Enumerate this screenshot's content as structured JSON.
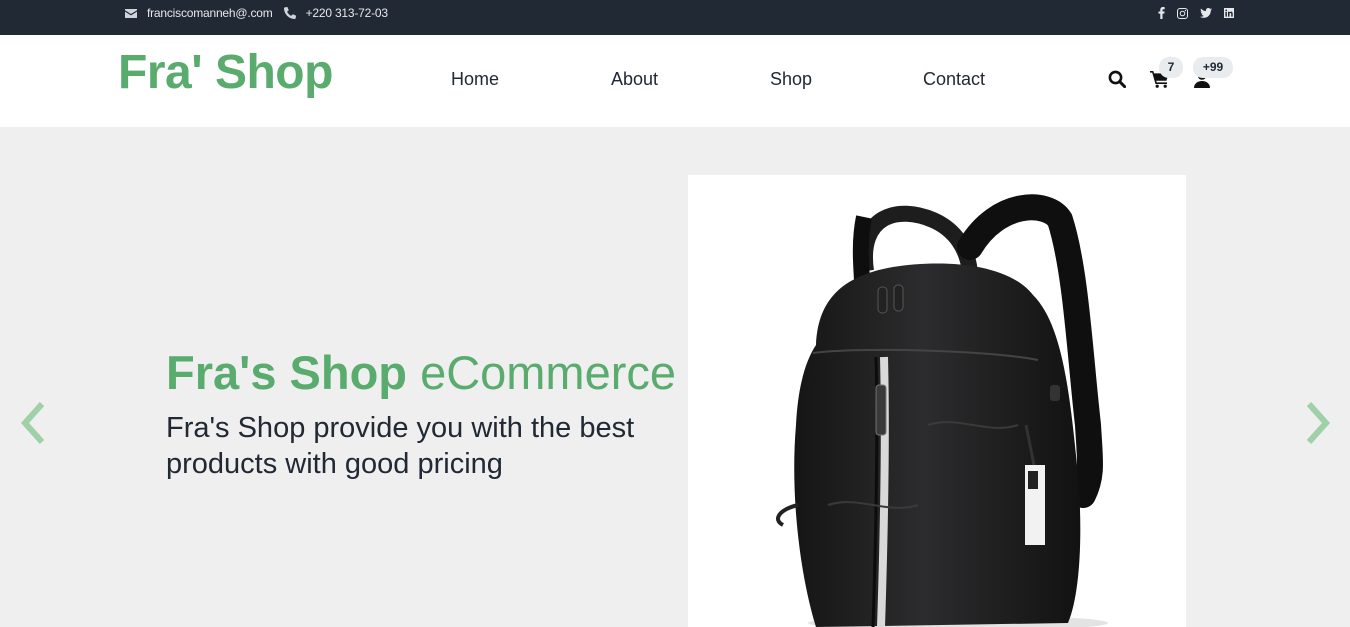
{
  "topbar": {
    "email": "franciscomanneh@.com",
    "phone": "+220 313-72-03",
    "icons": [
      "envelope-icon",
      "phone-icon",
      "facebook-icon",
      "instagram-icon",
      "twitter-icon",
      "linkedin-icon"
    ]
  },
  "header": {
    "logo": "Fra' Shop",
    "nav": [
      {
        "label": "Home"
      },
      {
        "label": "About"
      },
      {
        "label": "Shop"
      },
      {
        "label": "Contact"
      }
    ],
    "cart_count": "7",
    "user_count": "+99"
  },
  "hero": {
    "title_bold": "Fra's Shop",
    "title_light": "eCommerce",
    "subtitle": "Fra's Shop provide you with the best products with good pricing",
    "image": "black backpack product photo"
  },
  "colors": {
    "accent": "#59ab6e",
    "topbar_bg": "#212934",
    "hero_bg": "#efefef",
    "arrow": "#9fd0a8"
  }
}
